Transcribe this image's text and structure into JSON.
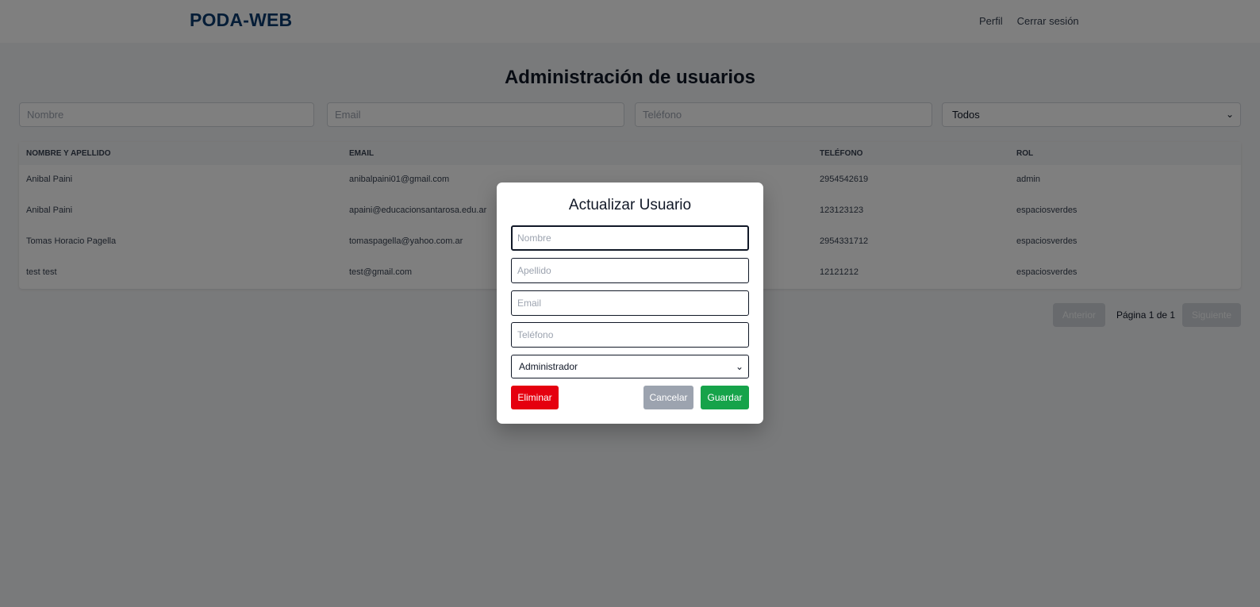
{
  "header": {
    "brand": "PODA-WEB",
    "links": [
      "Perfil",
      "Cerrar sesión"
    ]
  },
  "main": {
    "title": "Administración de usuarios",
    "filters": {
      "nombre_placeholder": "Nombre",
      "email_placeholder": "Email",
      "telefono_placeholder": "Teléfono",
      "rol_selected": "Todos"
    },
    "table": {
      "headers": [
        "NOMBRE Y APELLIDO",
        "EMAIL",
        "TELÉFONO",
        "ROL"
      ],
      "rows": [
        [
          "Anibal Paini",
          "anibalpaini01@gmail.com",
          "2954542619",
          "admin"
        ],
        [
          "Anibal Paini",
          "apaini@educacionsantarosa.edu.ar",
          "123123123",
          "espaciosverdes"
        ],
        [
          "Tomas Horacio Pagella",
          "tomaspagella@yahoo.com.ar",
          "2954331712",
          "espaciosverdes"
        ],
        [
          "test test",
          "test@gmail.com",
          "12121212",
          "espaciosverdes"
        ]
      ]
    },
    "pagination": {
      "prev_label": "Anterior",
      "info": "Página 1 de 1",
      "next_label": "Siguiente"
    }
  },
  "modal": {
    "title": "Actualizar Usuario",
    "fields": {
      "nombre_placeholder": "Nombre",
      "apellido_placeholder": "Apellido",
      "email_placeholder": "Email",
      "telefono_placeholder": "Teléfono",
      "rol_selected": "Administrador"
    },
    "buttons": {
      "delete": "Eliminar",
      "cancel": "Cancelar",
      "save": "Guardar"
    }
  },
  "colors": {
    "brand": "#0b3a6e",
    "delete": "#e5000f",
    "cancel": "#9ca3af",
    "save": "#16a34a",
    "overlay": "rgba(0,0,0,0.5)"
  }
}
